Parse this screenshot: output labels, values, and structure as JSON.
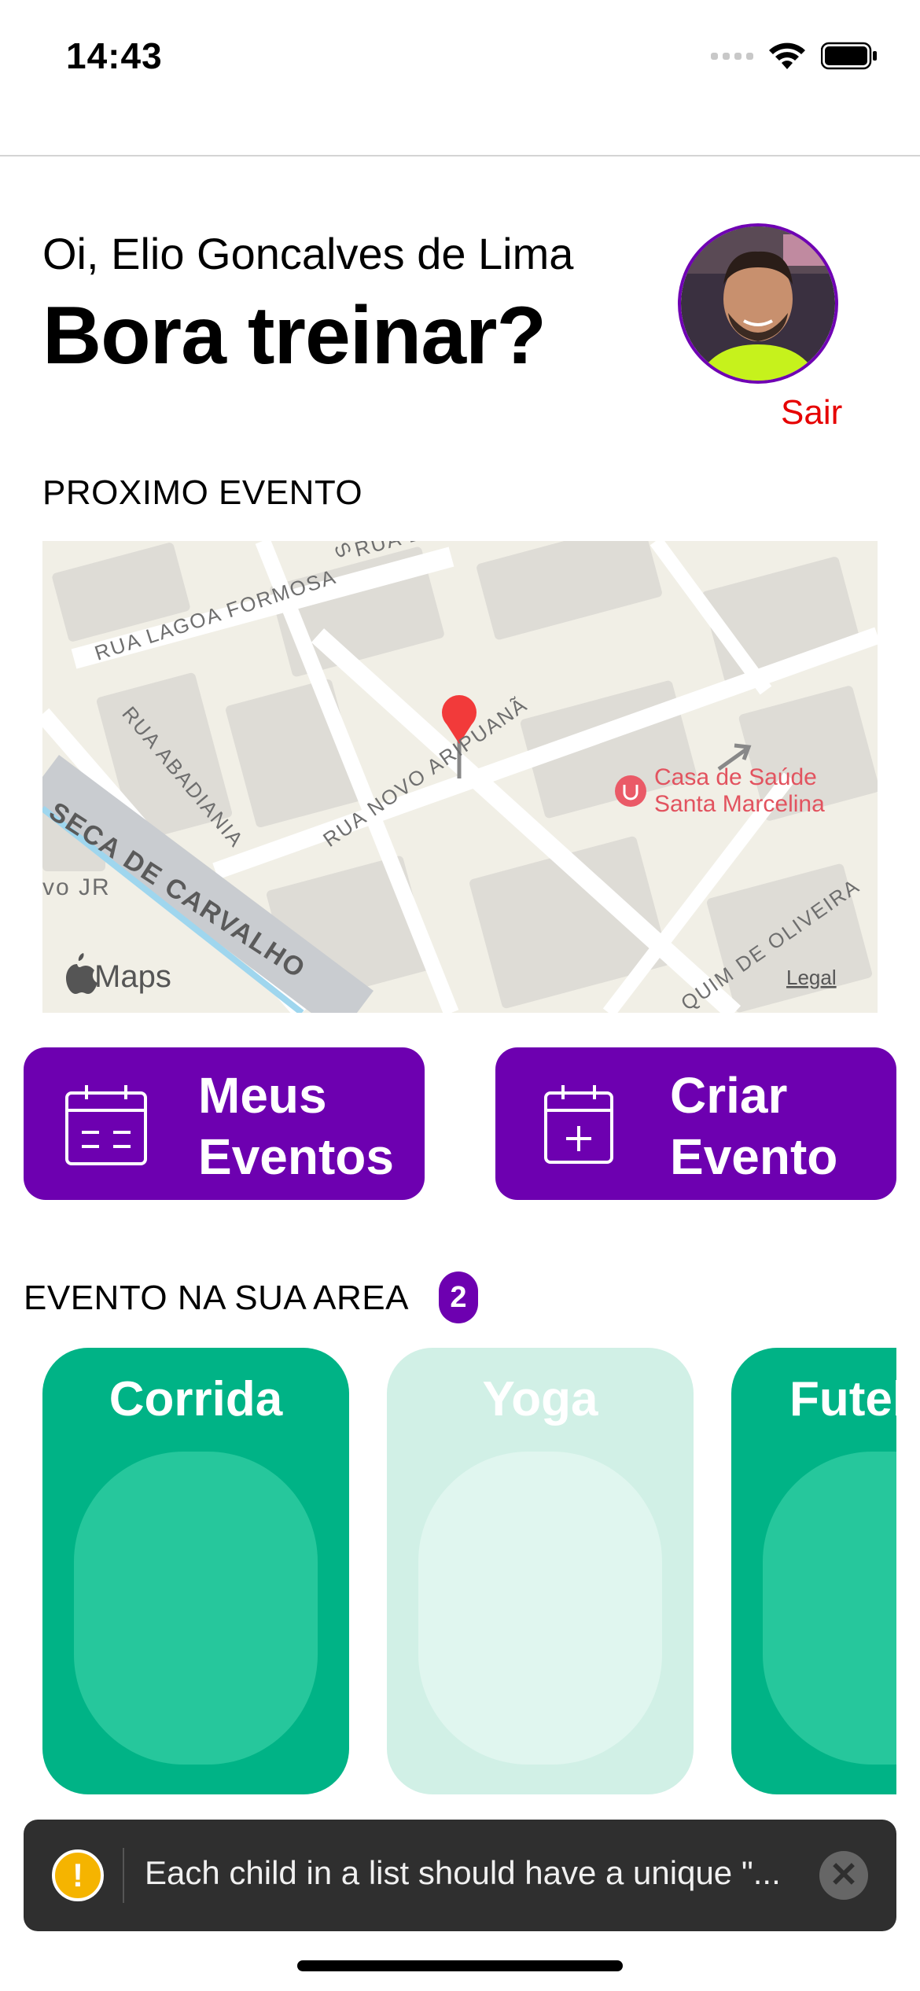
{
  "status_bar": {
    "time": "14:43"
  },
  "header": {
    "greeting": "Oi, Elio Goncalves de Lima",
    "headline": "Bora treinar?",
    "logout_label": "Sair"
  },
  "next_event": {
    "section_title": "PROXIMO EVENTO",
    "map": {
      "streets": [
        "RUA LAGOA FORMOSA",
        "RUA ABADIANIA",
        "RUA NOVO ARIPUANÃ",
        "SECA DE CARVALHO",
        "vo JR",
        "QUIM DE OLIVEIRA",
        "RUA D",
        "S"
      ],
      "poi_line1": "Casa de Saúde",
      "poi_line2": "Santa Marcelina",
      "attribution": "Maps",
      "legal": "Legal"
    }
  },
  "actions": {
    "my_events_line1": "Meus",
    "my_events_line2": "Eventos",
    "create_event_line1": "Criar",
    "create_event_line2": "Evento"
  },
  "area": {
    "section_title": "EVENTO NA SUA AREA",
    "count": "2",
    "cards": [
      {
        "title": "Corrida",
        "color": "#00b386",
        "inner": "#26c79c"
      },
      {
        "title": "Yoga",
        "color": "#d1f0e6",
        "inner": "#e0f6ef"
      },
      {
        "title": "Futebol",
        "color": "#00b386",
        "inner": "#26c79c"
      }
    ]
  },
  "toast": {
    "message": "Each child in a list should have a unique \"..."
  }
}
